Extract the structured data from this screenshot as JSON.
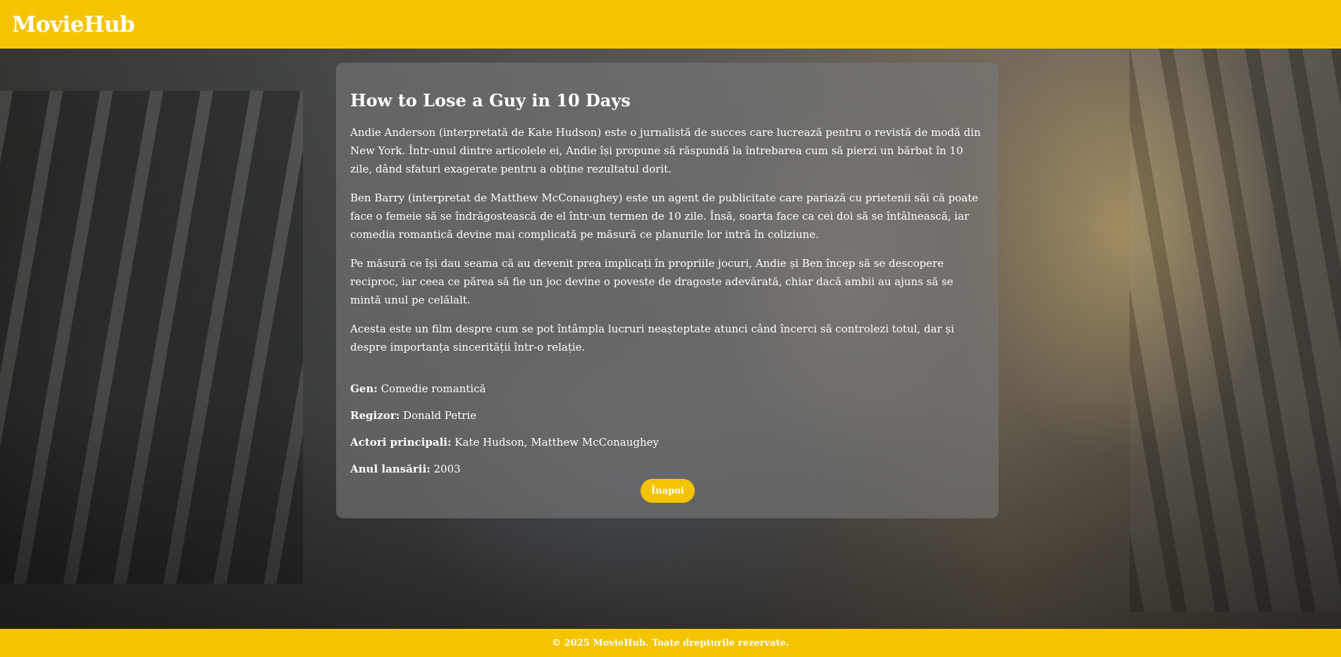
{
  "header": {
    "logo": "MovieHub"
  },
  "movie": {
    "title": "How to Lose a Guy in 10 Days",
    "paragraphs": [
      "Andie Anderson (interpretată de Kate Hudson) este o jurnalistă de succes care lucrează pentru o revistă de modă din New York. Într-unul dintre articolele ei, Andie își propune să răspundă la întrebarea cum să pierzi un bărbat în 10 zile, dând sfaturi exagerate pentru a obține rezultatul dorit.",
      "Ben Barry (interpretat de Matthew McConaughey) este un agent de publicitate care pariază cu prietenii săi că poate face o femeie să se îndrăgostească de el într-un termen de 10 zile. Însă, soarta face ca cei doi să se întâlnească, iar comedia romantică devine mai complicată pe măsură ce planurile lor intră în coliziune.",
      "Pe măsură ce își dau seama că au devenit prea implicați în propriile jocuri, Andie și Ben încep să se descopere reciproc, iar ceea ce părea să fie un joc devine o poveste de dragoste adevărată, chiar dacă ambii au ajuns să se mintă unul pe celălalt.",
      "Acesta este un film despre cum se pot întâmpla lucruri neașteptate atunci când încerci să controlezi totul, dar și despre importanța sincerității într-o relație."
    ],
    "details": [
      {
        "label": "Gen:",
        "value": "Comedie romantică"
      },
      {
        "label": "Regizor:",
        "value": "Donald Petrie"
      },
      {
        "label": "Actori principali:",
        "value": "Kate Hudson, Matthew McConaughey"
      },
      {
        "label": "Anul lansării:",
        "value": "2003"
      }
    ],
    "back_button_label": "Înapoi"
  },
  "footer": {
    "text": "© 2025 MovieHub. Toate drepturile rezervate."
  },
  "colors": {
    "accent": "#f5c400",
    "text": "#ffffff",
    "card_overlay": "rgba(120,120,120,0.62)"
  }
}
